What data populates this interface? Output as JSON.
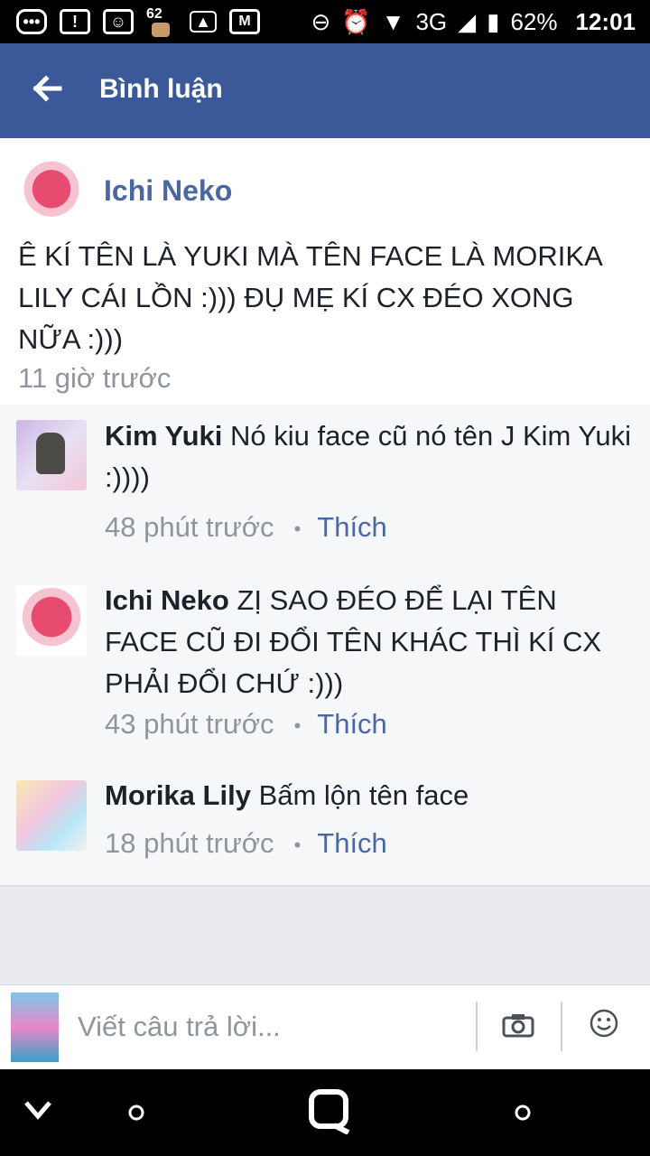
{
  "status_bar": {
    "notif_62": "62",
    "network": "3G",
    "battery": "62%",
    "time": "12:01"
  },
  "header": {
    "title": "Bình luận"
  },
  "post": {
    "author": "Ichi Neko",
    "text": "Ê KÍ TÊN LÀ YUKI MÀ TÊN FACE LÀ MORIKA LILY CÁI LỒN :))) ĐỤ MẸ KÍ CX ĐÉO XONG NỮA :)))",
    "time": "11 giờ trước"
  },
  "comments": [
    {
      "author": "Kim Yuki",
      "text": "Nó kiu face cũ nó tên J Kim Yuki :))))",
      "time": "48 phút trước",
      "dot": "•",
      "like": "Thích"
    },
    {
      "author": "Ichi Neko",
      "text": "ZỊ SAO ĐÉO ĐỂ LẠI TÊN FACE CŨ ĐI ĐỔI TÊN KHÁC THÌ KÍ CX PHẢI ĐỔI CHỨ :)))",
      "time": "43 phút trước",
      "dot": "•",
      "like": "Thích"
    },
    {
      "author": "Morika Lily",
      "text": "Bấm lộn tên face",
      "time": "18 phút trước",
      "dot": "•",
      "like": "Thích"
    }
  ],
  "reply": {
    "placeholder": "Viết câu trả lời..."
  },
  "icons": {
    "back": "arrow-left-icon",
    "camera": "camera-icon",
    "emoji": "smiley-icon"
  },
  "colors": {
    "brand_blue": "#3b5998",
    "name_blue": "#4b67a1",
    "meta_gray": "#90949c"
  }
}
